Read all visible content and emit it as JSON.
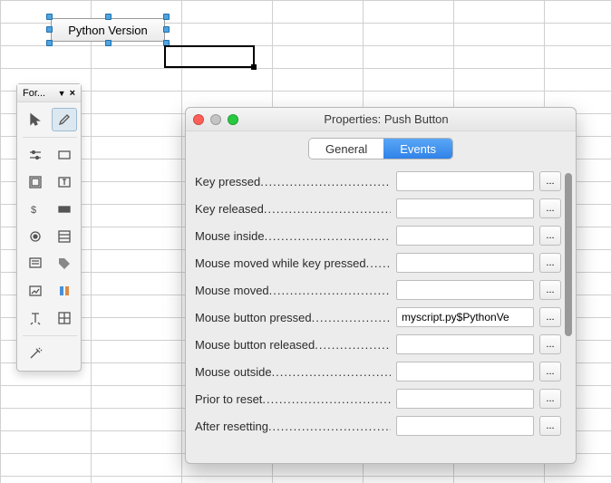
{
  "form_control": {
    "label": "Python Version"
  },
  "toolbox": {
    "title": "For..."
  },
  "properties_window": {
    "title": "Properties: Push Button",
    "tabs": {
      "general": "General",
      "events": "Events",
      "active": "events"
    },
    "events": [
      {
        "label": "Key pressed",
        "value": ""
      },
      {
        "label": "Key released",
        "value": ""
      },
      {
        "label": "Mouse inside",
        "value": ""
      },
      {
        "label": "Mouse moved while key pressed",
        "value": ""
      },
      {
        "label": "Mouse moved",
        "value": ""
      },
      {
        "label": "Mouse button pressed",
        "value": "myscript.py$PythonVe"
      },
      {
        "label": "Mouse button released",
        "value": ""
      },
      {
        "label": "Mouse outside",
        "value": ""
      },
      {
        "label": "Prior to reset",
        "value": ""
      },
      {
        "label": "After resetting",
        "value": ""
      }
    ],
    "browse_label": "..."
  }
}
